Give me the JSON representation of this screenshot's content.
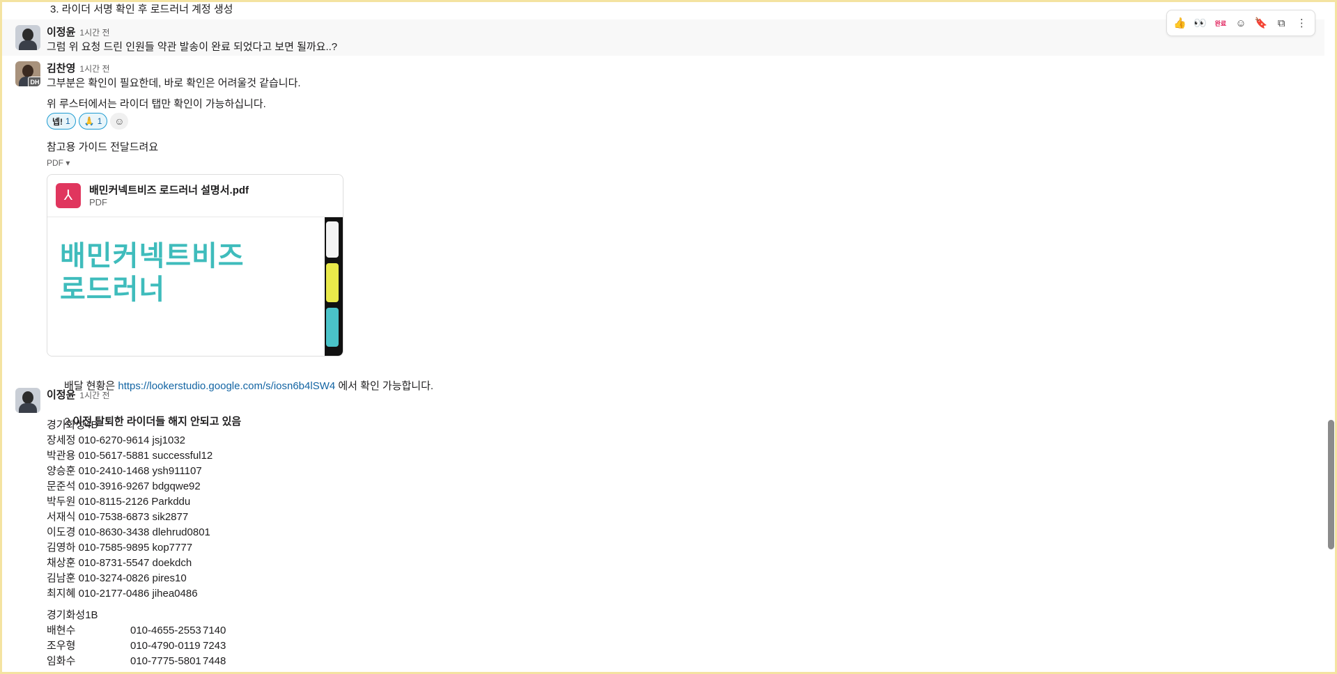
{
  "top_cut_text": "3.   라이더 서명 확인 후 로드러너 계정 생성",
  "toolbar": {
    "icons": [
      "thumbs-up-icon",
      "eyes-icon",
      "done-icon",
      "add-reaction-icon",
      "bookmark-icon",
      "reply-thread-icon",
      "more-icon"
    ],
    "glyphs": [
      "👍",
      "👀",
      "완료",
      "☺",
      "🔖",
      "⧉",
      "⋮"
    ]
  },
  "messages": [
    {
      "author": "이정윤",
      "time": "1시간 전",
      "lines": [
        "그럼 위 요청 드린 인원들 약관 발송이 완료 되었다고 보면 될까요..?"
      ]
    },
    {
      "author": "김찬영",
      "time": "1시간 전",
      "avatar_badge": "DH",
      "lines": [
        "그부분은 확인이 필요한데, 바로 확인은 어려울것 같습니다.",
        "위 루스터에서는 라이더 탭만 확인이 가능하십니다."
      ],
      "reactions": [
        {
          "emoji": "넵!",
          "count": "1"
        },
        {
          "emoji": "🙏",
          "count": "1"
        }
      ],
      "guide_text": "참고용 가이드 전달드려요",
      "attachment_toggle": "PDF ▾",
      "file": {
        "name": "배민커넥트비즈 로드러너 설명서.pdf",
        "type": "PDF",
        "preview_title_1": "배민커넥트비즈",
        "preview_title_2": "로드러너"
      },
      "delivery_prefix": "배달 현황은 ",
      "delivery_link": "https://lookerstudio.google.com/s/iosn6b4lSW4",
      "delivery_suffix": " 에서 확인 가능합니다."
    },
    {
      "author": "이정윤",
      "time": "1시간 전",
      "heading_num": "2.",
      "heading_bold": "이전 탈퇴한 라이더들 해지 안되고 있음",
      "group1": "경기화성4B",
      "riders": [
        "장세정 010-6270-9614 jsj1032",
        "박관용 010-5617-5881 successful12",
        "양승훈 010-2410-1468 ysh911107",
        "문준석 010-3916-9267 bdgqwe92",
        "박두원 010-8115-2126 Parkddu",
        "서재식 010-7538-6873 sik2877",
        "이도경 010-8630-3438 dlehrud0801",
        "김영하 010-7585-9895 kop7777",
        "채상훈 010-8731-5547 doekdch",
        "김남훈 010-3274-0826 pires10",
        "최지혜 010-2177-0486 jihea0486"
      ],
      "group2": "경기화성1B",
      "riders2": [
        {
          "name": "배현수",
          "phone": "010-4655-2553",
          "code": "7140"
        },
        {
          "name": "조우형",
          "phone": "010-4790-0119",
          "code": "7243"
        },
        {
          "name": "임화수",
          "phone": "010-7775-5801",
          "code": "7448"
        }
      ]
    }
  ]
}
